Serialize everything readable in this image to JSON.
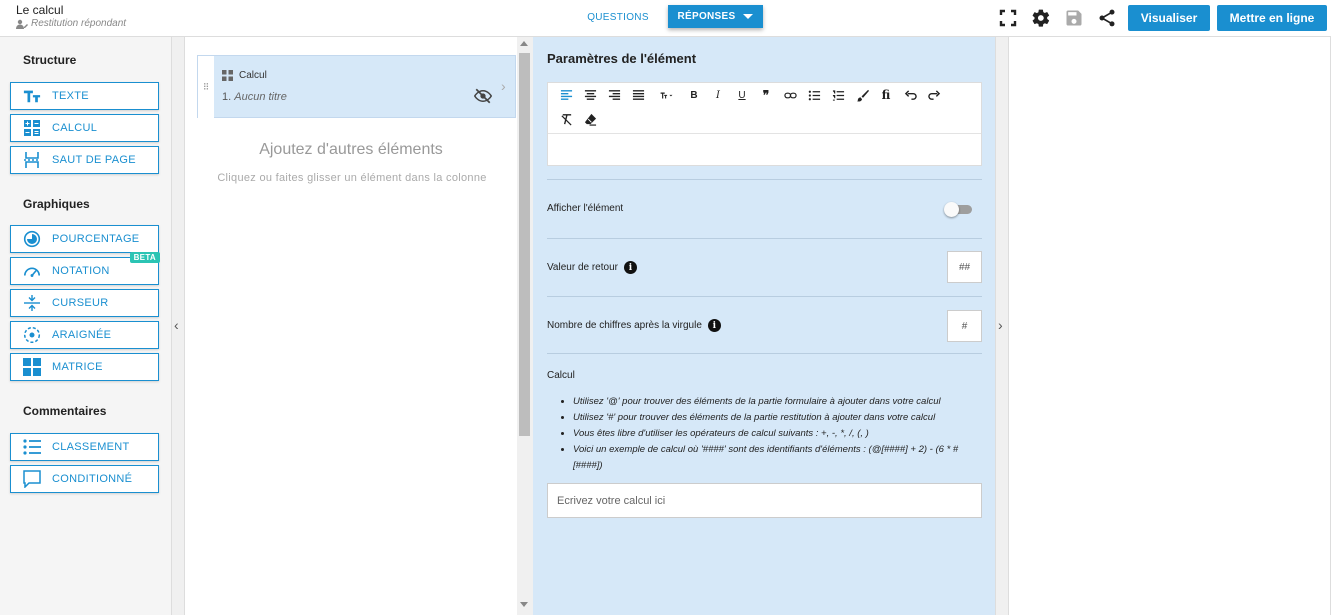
{
  "header": {
    "title": "Le calcul",
    "subtitle": "Restitution répondant",
    "tab_questions": "QUESTIONS",
    "tab_responses": "RÉPONSES",
    "btn_preview": "Visualiser",
    "btn_publish": "Mettre en ligne",
    "icons": [
      "fullscreen-icon",
      "gear-icon",
      "save-icon",
      "share-icon"
    ]
  },
  "sidebar": {
    "sections": [
      {
        "title": "Structure",
        "items": [
          {
            "label": "TEXTE",
            "icon": "text-icon"
          },
          {
            "label": "CALCUL",
            "icon": "calculator-icon"
          },
          {
            "label": "SAUT DE PAGE",
            "icon": "page-break-icon"
          }
        ]
      },
      {
        "title": "Graphiques",
        "items": [
          {
            "label": "POURCENTAGE",
            "icon": "pie-icon"
          },
          {
            "label": "NOTATION",
            "icon": "gauge-icon",
            "badge": "BETA"
          },
          {
            "label": "CURSEUR",
            "icon": "slider-icon"
          },
          {
            "label": "ARAIGNÉE",
            "icon": "radar-icon"
          },
          {
            "label": "MATRICE",
            "icon": "grid-icon"
          }
        ]
      },
      {
        "title": "Commentaires",
        "items": [
          {
            "label": "CLASSEMENT",
            "icon": "list-icon"
          },
          {
            "label": "CONDITIONNÉ",
            "icon": "comment-icon"
          }
        ]
      }
    ]
  },
  "middle": {
    "card_type": "Calcul",
    "card_number": "1.",
    "card_title": "Aucun titre",
    "add_title": "Ajoutez d'autres éléments",
    "add_subtitle": "Cliquez ou faites glisser un élément dans la colonne"
  },
  "params": {
    "title": "Paramètres de l'élément",
    "show_element_label": "Afficher l'élément",
    "show_element_on": false,
    "return_value_label": "Valeur de retour",
    "return_value_placeholder": "##",
    "decimals_label": "Nombre de chiffres après la virgule",
    "decimals_placeholder": "#",
    "calc_label": "Calcul",
    "calc_hints": [
      "Utilisez '@' pour trouver des éléments de la partie formulaire à ajouter dans votre calcul",
      "Utilisez '#' pour trouver des éléments de la partie restitution à ajouter dans votre calcul",
      "Vous êtes libre d'utiliser les opérateurs de calcul suivants : +, -, *, /, (, )",
      "Voici un exemple de calcul où '####' sont des identifiants d'éléments : (@[####] + 2) - (6 * #[####])"
    ],
    "calc_placeholder": "Ecrivez votre calcul ici"
  },
  "colors": {
    "accent": "#1a8fd0",
    "panel": "#d6e8f8",
    "beta": "#2bc4b4"
  }
}
